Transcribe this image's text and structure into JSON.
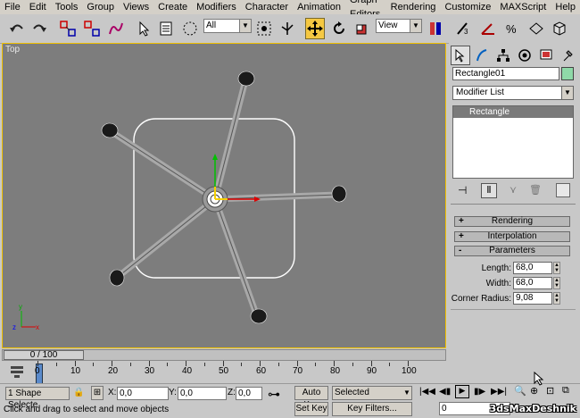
{
  "menu": [
    "File",
    "Edit",
    "Tools",
    "Group",
    "Views",
    "Create",
    "Modifiers",
    "Character",
    "Animation",
    "Graph Editors",
    "Rendering",
    "Customize",
    "MAXScript",
    "Help"
  ],
  "toolbar": {
    "selection_filter": "All",
    "ref_coord": "View"
  },
  "viewport": {
    "label": "Top"
  },
  "command_panel": {
    "object_name": "Rectangle01",
    "object_color": "#8fd9a8",
    "modifier_list": "Modifier List",
    "stack_item": "Rectangle",
    "rollouts": [
      {
        "sign": "+",
        "label": "Rendering"
      },
      {
        "sign": "+",
        "label": "Interpolation"
      },
      {
        "sign": "-",
        "label": "Parameters"
      }
    ],
    "params": [
      {
        "label": "Length:",
        "value": "68,0"
      },
      {
        "label": "Width:",
        "value": "68,0"
      },
      {
        "label": "Corner Radius:",
        "value": "9,08"
      }
    ]
  },
  "timeline": {
    "position": "0 / 100",
    "ticks": [
      "10",
      "20",
      "30",
      "40",
      "50",
      "60",
      "70",
      "80",
      "90",
      "100"
    ],
    "first_tick": "0"
  },
  "status": {
    "selection": "1 Shape Selecte",
    "x_label": "X:",
    "x_value": "0,0",
    "y_label": "Y:",
    "y_value": "0,0",
    "z_label": "Z:",
    "z_value": "0,0",
    "prompt": "Click and drag to select and move objects",
    "auto_key": "Auto Key",
    "set_key": "Set Key",
    "key_mode": "Selected",
    "key_filters": "Key Filters...",
    "frame": "0"
  },
  "watermark": "3dsMaxDeshnik"
}
